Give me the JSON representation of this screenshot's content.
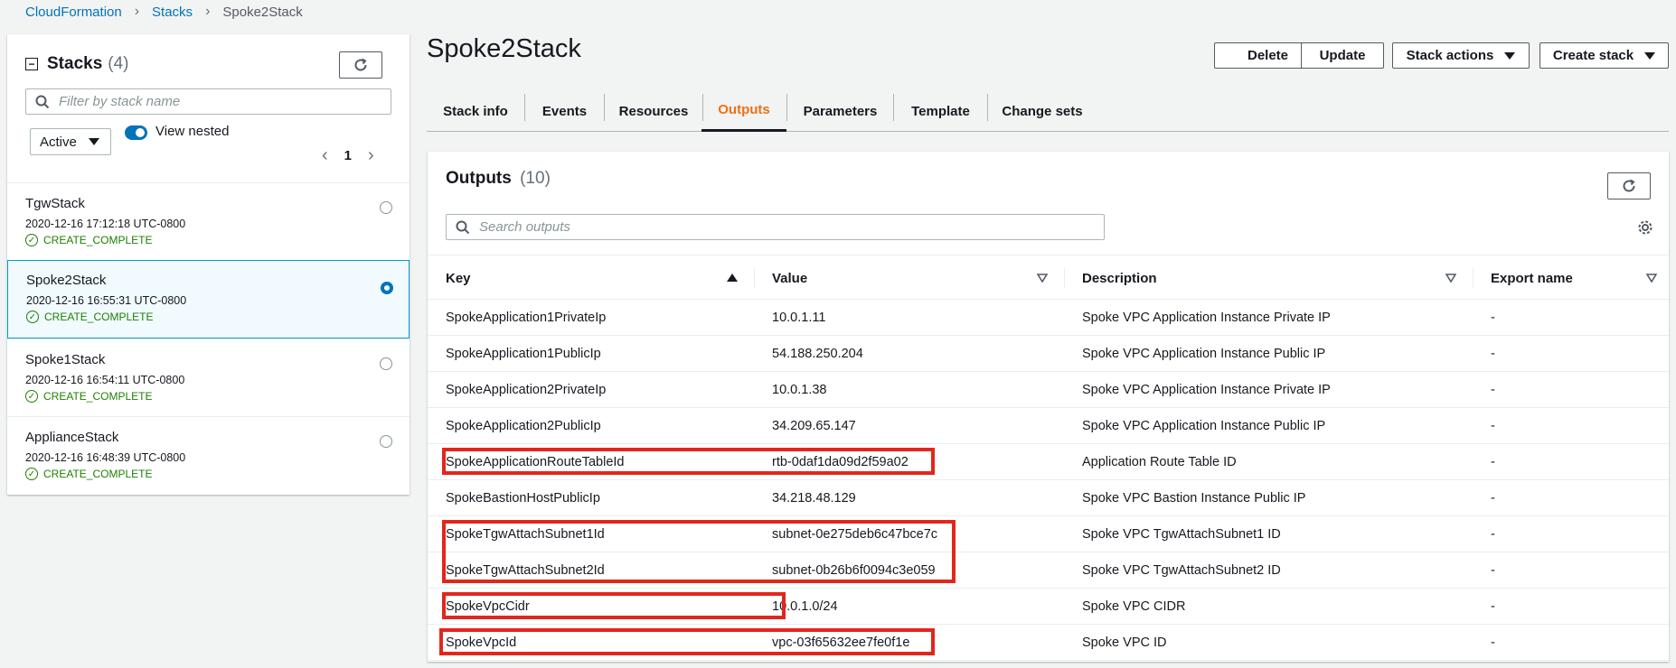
{
  "breadcrumb": {
    "root": "CloudFormation",
    "stacks": "Stacks",
    "current": "Spoke2Stack"
  },
  "stacks_panel": {
    "title": "Stacks",
    "count": "(4)",
    "filter_placeholder": "Filter by stack name",
    "status_filter": "Active",
    "view_nested_label": "View nested",
    "page": "1",
    "items": [
      {
        "name": "TgwStack",
        "date": "2020-12-16 17:12:18 UTC-0800",
        "status": "CREATE_COMPLETE"
      },
      {
        "name": "Spoke2Stack",
        "date": "2020-12-16 16:55:31 UTC-0800",
        "status": "CREATE_COMPLETE"
      },
      {
        "name": "Spoke1Stack",
        "date": "2020-12-16 16:54:11 UTC-0800",
        "status": "CREATE_COMPLETE"
      },
      {
        "name": "ApplianceStack",
        "date": "2020-12-16 16:48:39 UTC-0800",
        "status": "CREATE_COMPLETE"
      }
    ]
  },
  "header": {
    "title": "Spoke2Stack",
    "delete": "Delete",
    "update": "Update",
    "stack_actions": "Stack actions",
    "create_stack": "Create stack"
  },
  "tabs": [
    "Stack info",
    "Events",
    "Resources",
    "Outputs",
    "Parameters",
    "Template",
    "Change sets"
  ],
  "outputs": {
    "title": "Outputs",
    "count": "(10)",
    "search_placeholder": "Search outputs",
    "columns": {
      "key": "Key",
      "value": "Value",
      "description": "Description",
      "export": "Export name"
    },
    "rows": [
      {
        "key": "SpokeApplication1PrivateIp",
        "value": "10.0.1.11",
        "description": "Spoke VPC Application Instance Private IP",
        "export": "-"
      },
      {
        "key": "SpokeApplication1PublicIp",
        "value": "54.188.250.204",
        "description": "Spoke VPC Application Instance Public IP",
        "export": "-"
      },
      {
        "key": "SpokeApplication2PrivateIp",
        "value": "10.0.1.38",
        "description": "Spoke VPC Application Instance Private IP",
        "export": "-"
      },
      {
        "key": "SpokeApplication2PublicIp",
        "value": "34.209.65.147",
        "description": "Spoke VPC Application Instance Public IP",
        "export": "-"
      },
      {
        "key": "SpokeApplicationRouteTableId",
        "value": "rtb-0daf1da09d2f59a02",
        "description": "Application Route Table ID",
        "export": "-"
      },
      {
        "key": "SpokeBastionHostPublicIp",
        "value": "34.218.48.129",
        "description": "Spoke VPC Bastion Instance Public IP",
        "export": "-"
      },
      {
        "key": "SpokeTgwAttachSubnet1Id",
        "value": "subnet-0e275deb6c47bce7c",
        "description": "Spoke VPC TgwAttachSubnet1 ID",
        "export": "-"
      },
      {
        "key": "SpokeTgwAttachSubnet2Id",
        "value": "subnet-0b26b6f0094c3e059",
        "description": "Spoke VPC TgwAttachSubnet2 ID",
        "export": "-"
      },
      {
        "key": "SpokeVpcCidr",
        "value": "10.0.1.0/24",
        "description": "Spoke VPC CIDR",
        "export": "-"
      },
      {
        "key": "SpokeVpcId",
        "value": "vpc-03f65632ee7fe0f1e",
        "description": "Spoke VPC ID",
        "export": "-"
      }
    ]
  },
  "colors": {
    "link": "#0073bb",
    "active_tab": "#ec7211",
    "success": "#1d8102",
    "highlight": "#e3261c"
  }
}
